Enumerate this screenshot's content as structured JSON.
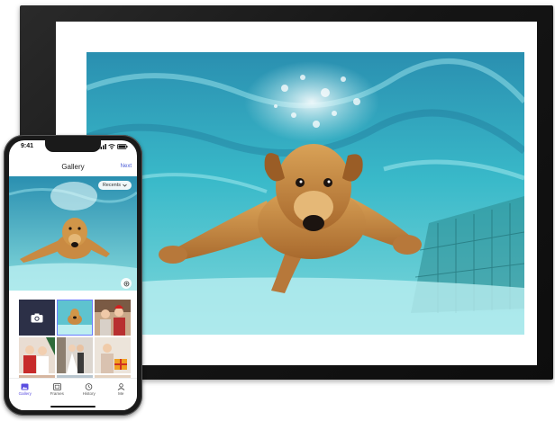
{
  "phone": {
    "status": {
      "time": "9:41"
    },
    "header": {
      "title": "Gallery",
      "next_label": "Next"
    },
    "album_selector": {
      "label": "Recents"
    },
    "grid_icons": [
      "camera-icon"
    ],
    "tabs": [
      {
        "label": "Gallery",
        "icon": "gallery-icon",
        "active": true
      },
      {
        "label": "Frames",
        "icon": "frames-icon",
        "active": false
      },
      {
        "label": "History",
        "icon": "history-icon",
        "active": false
      },
      {
        "label": "Me",
        "icon": "person-icon",
        "active": false
      }
    ]
  },
  "colors": {
    "accent": "#5a4de0",
    "link": "#4a5bd6",
    "frame": "#151515",
    "water": "#2fb3c4",
    "dog": "#c98a42"
  }
}
